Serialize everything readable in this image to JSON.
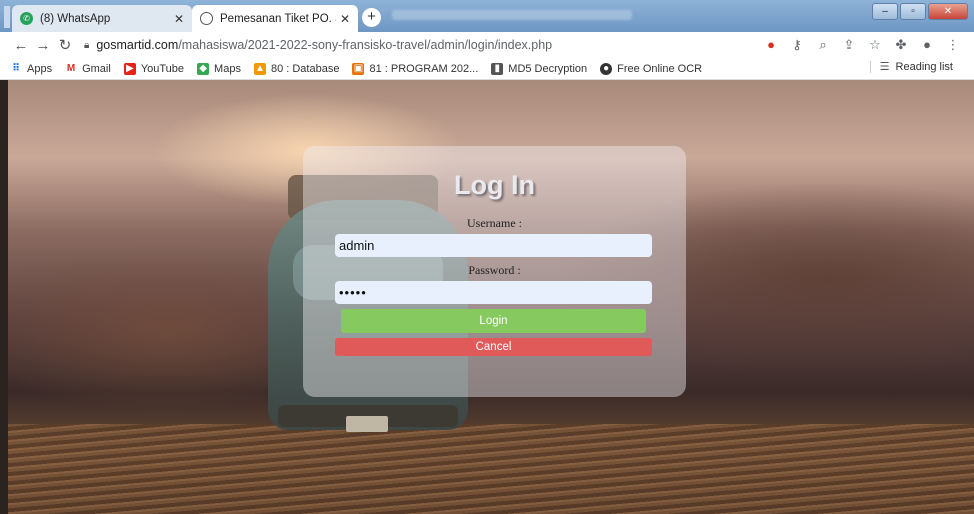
{
  "browser": {
    "tabs": [
      {
        "title": "(8) WhatsApp",
        "icon": "whatsapp-icon",
        "active": false
      },
      {
        "title": "Pemesanan Tiket PO. SUMBA PU",
        "icon": "globe-icon",
        "active": true
      }
    ],
    "address": {
      "host": "gosmartid.com",
      "path": "/mahasiswa/2021-2022-sony-fransisko-travel/admin/login/index.php"
    },
    "bookmarks": [
      {
        "label": "Apps",
        "icon": "apps-grid-icon"
      },
      {
        "label": "Gmail",
        "icon": "gmail-icon"
      },
      {
        "label": "YouTube",
        "icon": "youtube-icon"
      },
      {
        "label": "Maps",
        "icon": "maps-icon"
      },
      {
        "label": "80 : Database",
        "icon": "database-icon"
      },
      {
        "label": "81 : PROGRAM 202...",
        "icon": "program-icon"
      },
      {
        "label": "MD5 Decryption",
        "icon": "md5-icon"
      },
      {
        "label": "Free Online OCR",
        "icon": "ocr-icon"
      }
    ],
    "reading_list": "Reading list"
  },
  "login": {
    "title": "Log In",
    "username_label": "Username :",
    "username_value": "admin",
    "password_label": "Password :",
    "password_value": "•••••",
    "login_button": "Login",
    "cancel_button": "Cancel"
  },
  "colors": {
    "login_button": "#86c95e",
    "cancel_button": "#e05a5a",
    "input_bg": "#e8f0fe"
  }
}
